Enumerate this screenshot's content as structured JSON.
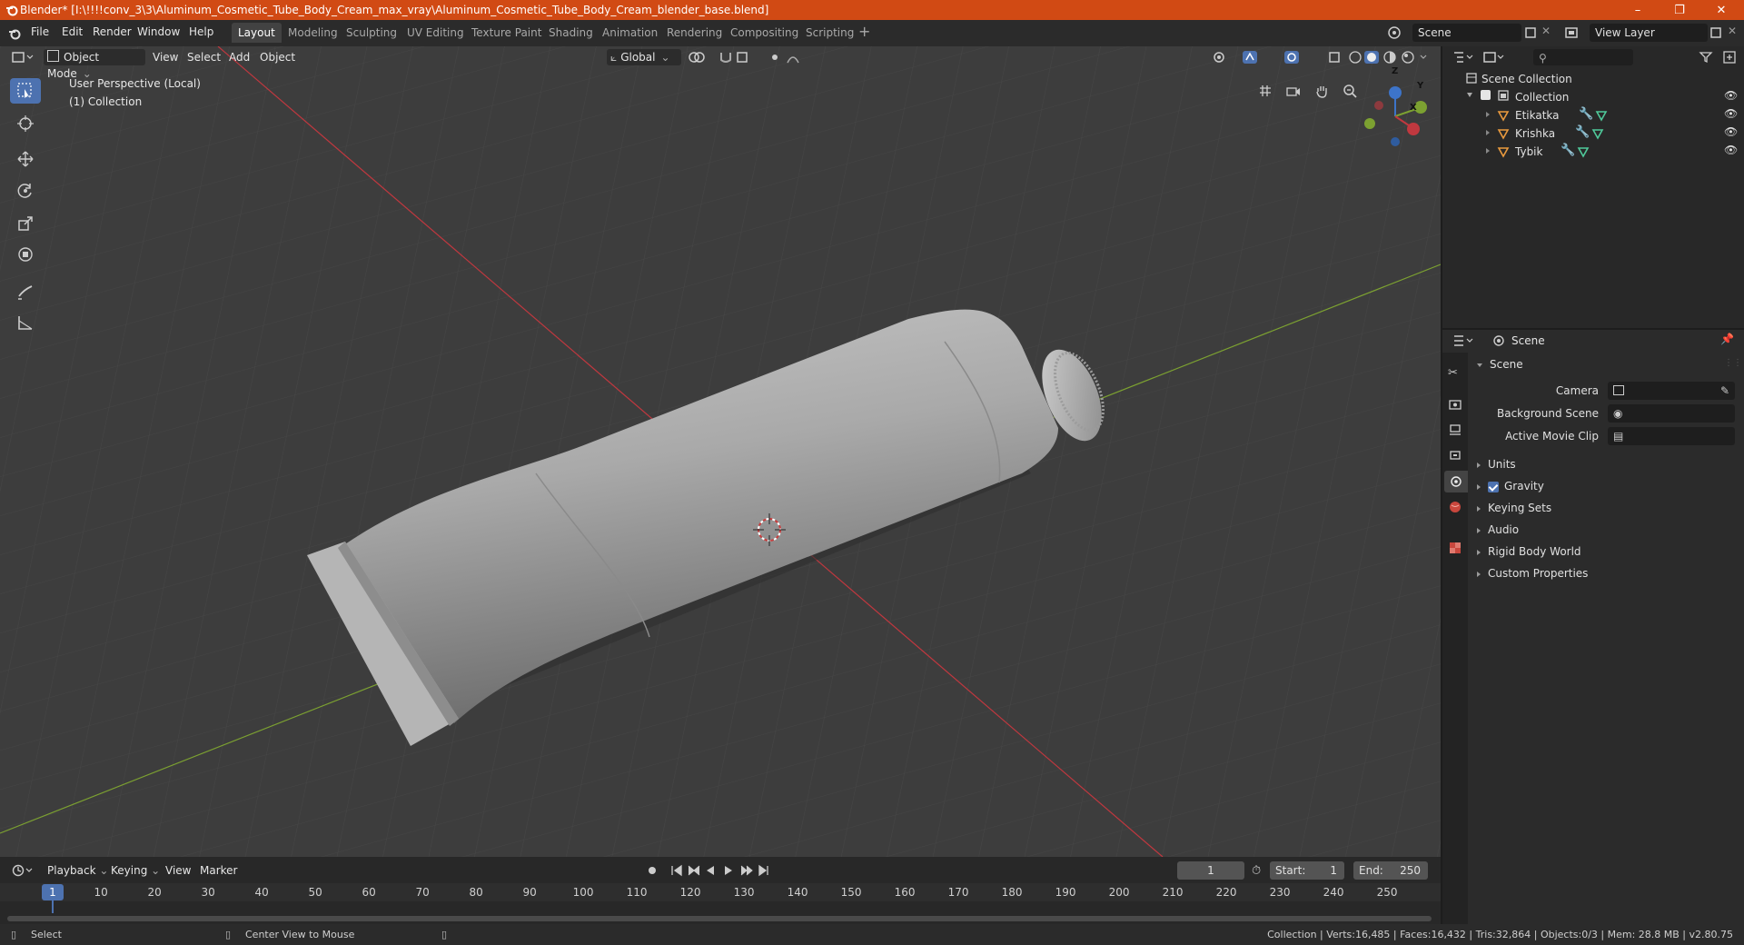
{
  "window": {
    "title": "Blender* [I:\\!!!!conv_3\\3\\Aluminum_Cosmetic_Tube_Body_Cream_max_vray\\Aluminum_Cosmetic_Tube_Body_Cream_blender_base.blend]",
    "minimize": "–",
    "restore": "❐",
    "close": "✕"
  },
  "menu": [
    "File",
    "Edit",
    "Render",
    "Window",
    "Help"
  ],
  "workspaces": [
    "Layout",
    "Modeling",
    "Sculpting",
    "UV Editing",
    "Texture Paint",
    "Shading",
    "Animation",
    "Rendering",
    "Compositing",
    "Scripting"
  ],
  "active_workspace": "Layout",
  "scene_field": "Scene",
  "view_layer_field": "View Layer",
  "viewport": {
    "mode": "Object Mode",
    "menus": [
      "View",
      "Select",
      "Add",
      "Object"
    ],
    "orientation": "Global",
    "overlay_line1": "User Perspective (Local)",
    "overlay_line2": "(1) Collection",
    "gizmo_axes": {
      "x": "X",
      "y": "Y",
      "z": "Z"
    }
  },
  "outliner": {
    "root": "Scene Collection",
    "collection": "Collection",
    "objects": [
      "Etikatka",
      "Krishka",
      "Tybik"
    ]
  },
  "properties": {
    "header": "Scene",
    "section": "Scene",
    "fields": [
      {
        "label": "Camera"
      },
      {
        "label": "Background Scene"
      },
      {
        "label": "Active Movie Clip"
      }
    ],
    "panels": [
      "Units",
      "Gravity",
      "Keying Sets",
      "Audio",
      "Rigid Body World",
      "Custom Properties"
    ],
    "gravity_checked": true
  },
  "timeline": {
    "menus": [
      "Playback",
      "Keying",
      "View",
      "Marker"
    ],
    "current_frame": "1",
    "start_label": "Start:",
    "start": "1",
    "end_label": "End:",
    "end": "250",
    "ticks": [
      "1",
      "10",
      "20",
      "30",
      "40",
      "50",
      "60",
      "70",
      "80",
      "90",
      "100",
      "110",
      "120",
      "130",
      "140",
      "150",
      "160",
      "170",
      "180",
      "190",
      "200",
      "210",
      "220",
      "230",
      "240",
      "250"
    ]
  },
  "statusbar": {
    "left1": "Select",
    "left2": "Center View to Mouse",
    "right": "Collection | Verts:16,485 | Faces:16,432 | Tris:32,864 | Objects:0/3 | Mem: 28.8 MB | v2.80.75"
  },
  "colors": {
    "titlebar": "#d14a14",
    "accent": "#4d72b0",
    "viewport_bg": "#3d3d3d",
    "x_axis": "#c0383f",
    "y_axis": "#7ca131"
  }
}
